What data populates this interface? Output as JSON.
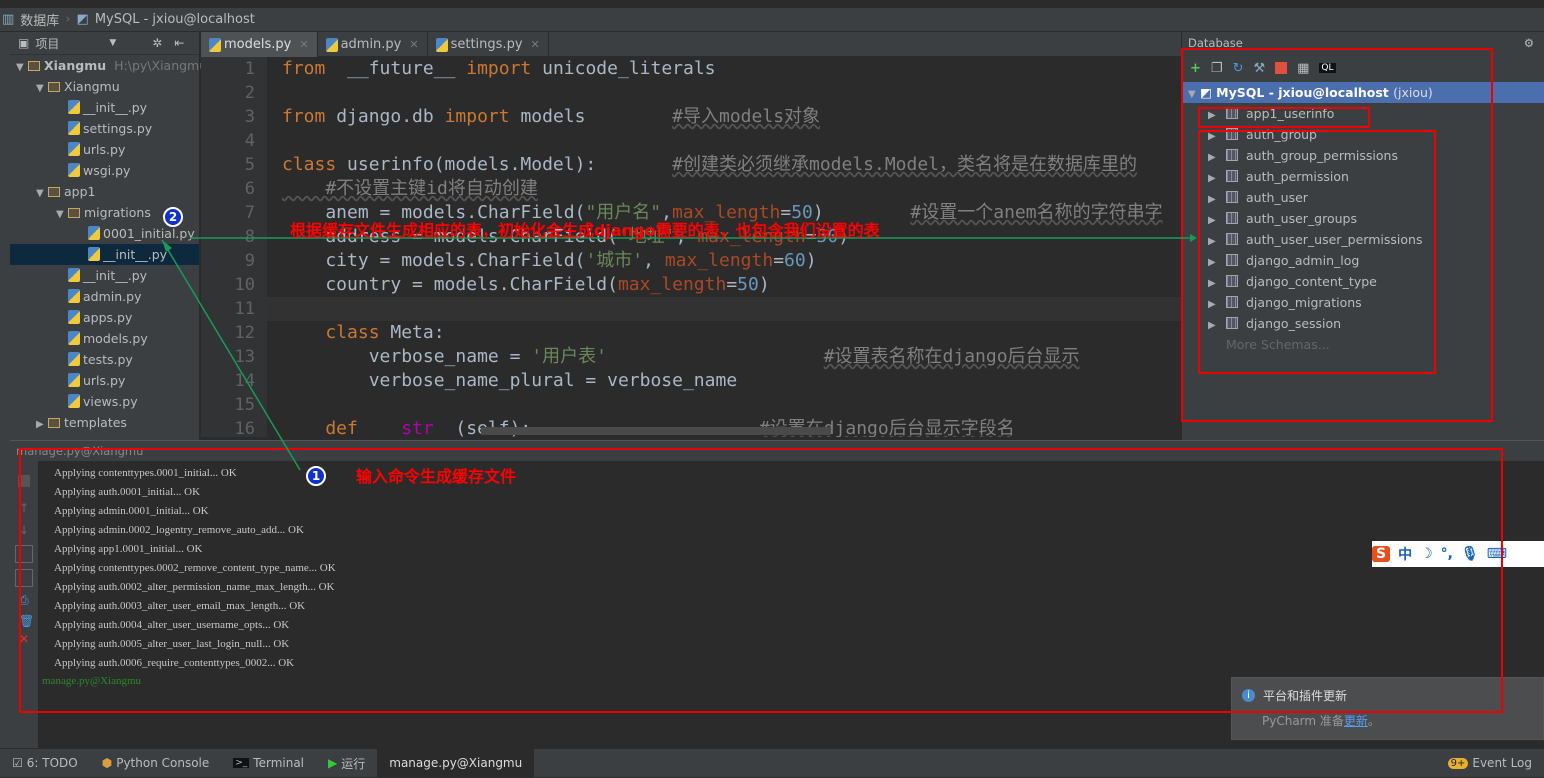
{
  "nav": {
    "db_label": "数据库",
    "conn_label": "MySQL - jxiou@localhost"
  },
  "project": {
    "header": "项目",
    "items": [
      {
        "label": "Xiangmu",
        "extra": "H:\\py\\Xiangmu",
        "indent": 0,
        "type": "folder",
        "open": true
      },
      {
        "label": "Xiangmu",
        "indent": 1,
        "type": "folder",
        "open": true
      },
      {
        "label": "__init__.py",
        "indent": 2,
        "type": "py"
      },
      {
        "label": "settings.py",
        "indent": 2,
        "type": "py"
      },
      {
        "label": "urls.py",
        "indent": 2,
        "type": "py"
      },
      {
        "label": "wsgi.py",
        "indent": 2,
        "type": "py"
      },
      {
        "label": "app1",
        "indent": 1,
        "type": "folder",
        "open": true
      },
      {
        "label": "migrations",
        "indent": 2,
        "type": "folder",
        "open": true
      },
      {
        "label": "0001_initial.py",
        "indent": 3,
        "type": "py"
      },
      {
        "label": "__init__.py",
        "indent": 3,
        "type": "py",
        "selected": true
      },
      {
        "label": "__init__.py",
        "indent": 2,
        "type": "py"
      },
      {
        "label": "admin.py",
        "indent": 2,
        "type": "py"
      },
      {
        "label": "apps.py",
        "indent": 2,
        "type": "py"
      },
      {
        "label": "models.py",
        "indent": 2,
        "type": "py"
      },
      {
        "label": "tests.py",
        "indent": 2,
        "type": "py"
      },
      {
        "label": "urls.py",
        "indent": 2,
        "type": "py"
      },
      {
        "label": "views.py",
        "indent": 2,
        "type": "py"
      },
      {
        "label": "templates",
        "indent": 1,
        "type": "folder",
        "open": false
      }
    ]
  },
  "tabs": [
    {
      "label": "models.py",
      "active": true
    },
    {
      "label": "admin.py"
    },
    {
      "label": "settings.py"
    }
  ],
  "code": [
    [
      [
        "kw",
        "from"
      ],
      [
        "",
        "  __future__ "
      ],
      [
        "kw",
        "import"
      ],
      [
        "",
        " unicode_literals"
      ]
    ],
    [],
    [
      [
        "kw",
        "from"
      ],
      [
        "",
        " django.db "
      ],
      [
        "kw",
        "import"
      ],
      [
        "",
        " models        "
      ],
      [
        "cm",
        "#导入models对象"
      ]
    ],
    [],
    [
      [
        "kw",
        "class"
      ],
      [
        "",
        " userinfo(models.Model):       "
      ],
      [
        "cm",
        "#创建类必须继承models.Model，类名将是在数据库里的"
      ]
    ],
    [
      [
        "cm",
        "    #不设置主键id将自动创建"
      ]
    ],
    [
      [
        "",
        "    anem = models.CharField("
      ],
      [
        "str",
        "\"用户名\""
      ],
      [
        "",
        ","
      ],
      [
        "prm",
        "max_length"
      ],
      [
        "",
        "="
      ],
      [
        "num",
        "50"
      ],
      [
        "",
        ")        "
      ],
      [
        "cm",
        "#设置一个anem名称的字符串字"
      ]
    ],
    [
      [
        "",
        "    address = models.CharField("
      ],
      [
        "str",
        "'地址'"
      ],
      [
        "",
        ", "
      ],
      [
        "prm",
        "max_length"
      ],
      [
        "",
        "="
      ],
      [
        "num",
        "50"
      ],
      [
        "",
        ")"
      ]
    ],
    [
      [
        "",
        "    city = models.CharField("
      ],
      [
        "str",
        "'城市'"
      ],
      [
        "",
        ", "
      ],
      [
        "prm",
        "max_length"
      ],
      [
        "",
        "="
      ],
      [
        "num",
        "60"
      ],
      [
        "",
        ")"
      ]
    ],
    [
      [
        "",
        "    country = models.CharField("
      ],
      [
        "prm",
        "max_length"
      ],
      [
        "",
        "="
      ],
      [
        "num",
        "50"
      ],
      [
        "",
        ")"
      ]
    ],
    [],
    [
      [
        "kw",
        "    class"
      ],
      [
        "",
        " Meta:"
      ]
    ],
    [
      [
        "",
        "        verbose_name = "
      ],
      [
        "str",
        "'用户表'"
      ],
      [
        "",
        "                    "
      ],
      [
        "cm",
        "#设置表名称在django后台显示"
      ]
    ],
    [
      [
        "",
        "        verbose_name_plural = verbose_name"
      ]
    ],
    [],
    [
      [
        "kw",
        "    def"
      ],
      [
        "",
        "  "
      ],
      [
        "mg",
        "__str__"
      ],
      [
        "",
        "(self):                     "
      ],
      [
        "cm",
        "#设置在django后台显示字段名"
      ]
    ]
  ],
  "database": {
    "header": "Database",
    "root": "MySQL - jxiou@localhost",
    "root_extra": "(jxiou)",
    "tables": [
      "app1_userinfo",
      "auth_group",
      "auth_group_permissions",
      "auth_permission",
      "auth_user",
      "auth_user_groups",
      "auth_user_user_permissions",
      "django_admin_log",
      "django_content_type",
      "django_migrations",
      "django_session"
    ],
    "more": "More Schemas..."
  },
  "run": {
    "title": "manage.py@Xiangmu",
    "lines": [
      "Applying contenttypes.0001_initial... OK",
      "Applying auth.0001_initial... OK",
      "Applying admin.0001_initial... OK",
      "Applying admin.0002_logentry_remove_auto_add... OK",
      "Applying app1.0001_initial... OK",
      "Applying contenttypes.0002_remove_content_type_name... OK",
      "Applying auth.0002_alter_permission_name_max_length... OK",
      "Applying auth.0003_alter_user_email_max_length... OK",
      "Applying auth.0004_alter_user_username_opts... OK",
      "Applying auth.0005_alter_user_last_login_null... OK",
      "Applying auth.0006_require_contenttypes_0002... OK"
    ],
    "prompt": "manage.py@Xiangmu"
  },
  "annotations": {
    "one": "1",
    "two": "2",
    "text1": "输入命令生成缓存文件",
    "text2": "根据缓存文件生成相应的表，初始化会生成django需要的表，也包含我们设置的表"
  },
  "notification": {
    "title": "平台和插件更新",
    "body": "PyCharm 准备",
    "link": "更新",
    "end": "。"
  },
  "ime": {
    "mode": "中"
  },
  "bottom": {
    "todo": "6: TODO",
    "console": "Python Console",
    "terminal": "Terminal",
    "run": "运行",
    "manage": "manage.py@Xiangmu",
    "event": "Event Log",
    "event_count": "9+"
  }
}
